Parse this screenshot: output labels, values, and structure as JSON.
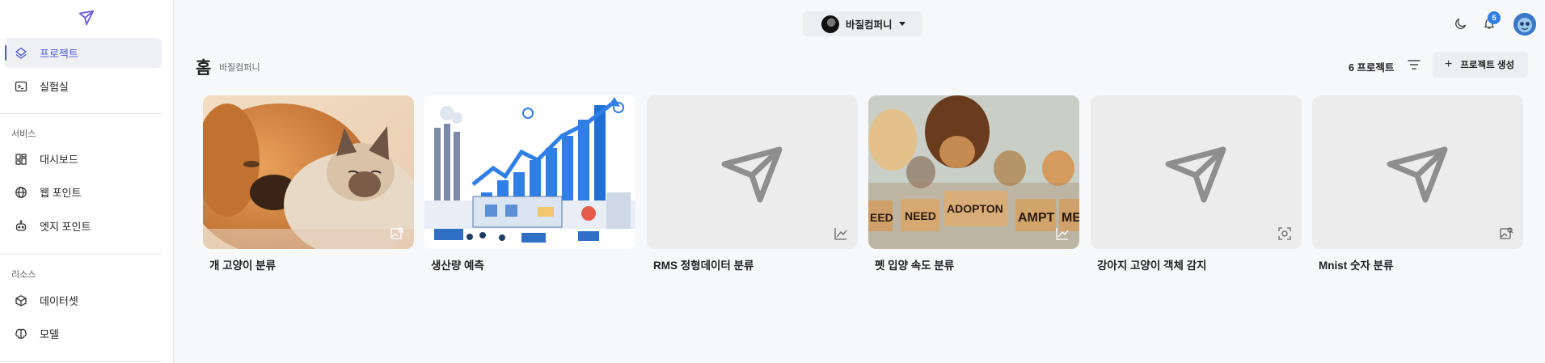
{
  "app": {
    "brand_icon": "paper-plane-logo"
  },
  "sidebar": {
    "items_top": [
      {
        "label": "프로젝트",
        "icon": "layers-icon",
        "active": true
      },
      {
        "label": "실험실",
        "icon": "terminal-icon",
        "active": false
      }
    ],
    "service_section": "서비스",
    "service_items": [
      {
        "label": "대시보드",
        "icon": "dashboard-icon"
      },
      {
        "label": "웹 포인트",
        "icon": "globe-icon"
      },
      {
        "label": "엣지 포인트",
        "icon": "robot-icon"
      }
    ],
    "resource_section": "리소스",
    "resource_items": [
      {
        "label": "데이터셋",
        "icon": "box-icon"
      },
      {
        "label": "모델",
        "icon": "brain-icon"
      }
    ]
  },
  "topbar": {
    "company_name": "바질컴퍼니",
    "notification_count": "5",
    "icons": [
      "moon-icon",
      "bell-icon",
      "user-avatar"
    ]
  },
  "header": {
    "title": "홈",
    "subtitle": "바질컴퍼니",
    "project_count": "6 프로젝트",
    "create_label": "프로젝트 생성"
  },
  "projects": [
    {
      "title": "개 고양이 분류",
      "thumbnail": "dog-cat-photo",
      "type_icon": "image-classification-icon"
    },
    {
      "title": "생산량 예측",
      "thumbnail": "factory-chart-illustration",
      "type_icon": "none"
    },
    {
      "title": "RMS 정형데이터 분류",
      "thumbnail": "placeholder-plane",
      "type_icon": "line-chart-icon"
    },
    {
      "title": "펫 입양 속도 분류",
      "thumbnail": "pets-adoption-photo",
      "type_icon": "line-chart-icon",
      "sign_texts": [
        "EED",
        "NEED",
        "ADOPTON",
        "AMPT",
        "ME"
      ]
    },
    {
      "title": "강아지 고양이 객체 감지",
      "thumbnail": "placeholder-plane",
      "type_icon": "object-detection-icon"
    },
    {
      "title": "Mnist 숫자 분류",
      "thumbnail": "placeholder-plane",
      "type_icon": "image-classification-icon"
    }
  ],
  "colors": {
    "accent": "#4a57d6",
    "badge": "#2f7fe6",
    "sidebar_bg": "#ffffff",
    "page_bg": "#f7f8fa"
  }
}
